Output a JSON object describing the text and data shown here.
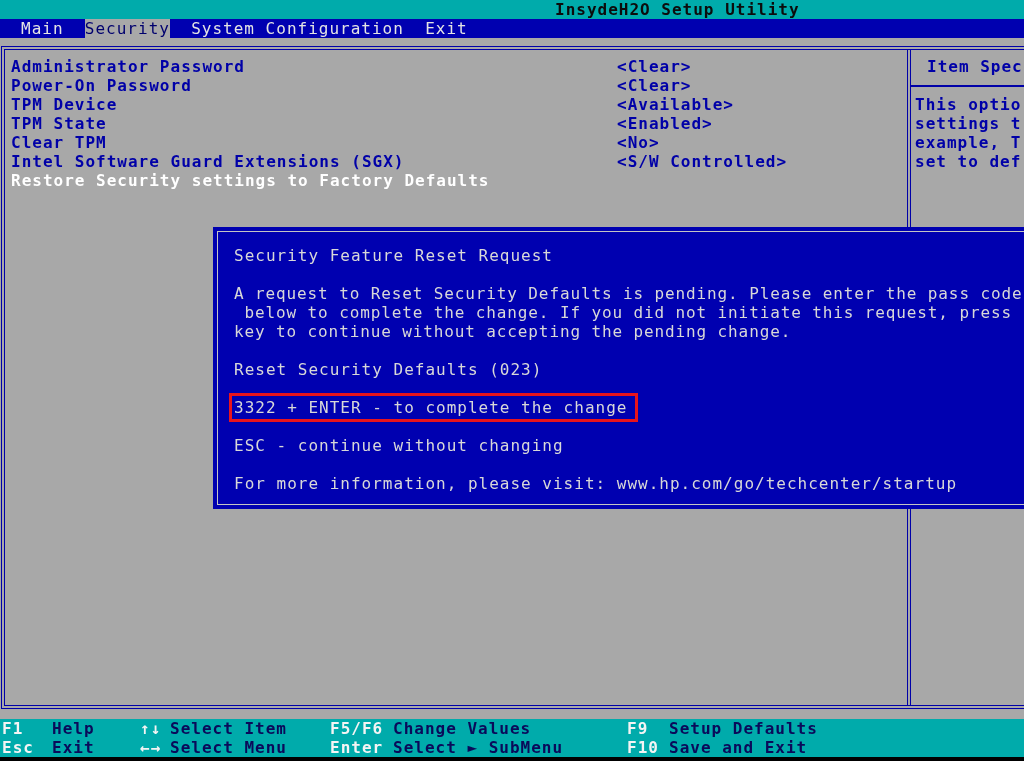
{
  "window": {
    "title": "InsydeH2O Setup Utility"
  },
  "tabs": [
    {
      "label": "Main",
      "selected": false
    },
    {
      "label": "Security",
      "selected": true
    },
    {
      "label": "System Configuration",
      "selected": false
    },
    {
      "label": "Exit",
      "selected": false
    }
  ],
  "settings": [
    {
      "label": "Administrator Password",
      "value": "<Clear>",
      "selected": false
    },
    {
      "label": "Power-On Password",
      "value": "<Clear>",
      "selected": false
    },
    {
      "label": "TPM Device",
      "value": "<Available>",
      "selected": false
    },
    {
      "label": "TPM State",
      "value": "<Enabled>",
      "selected": false
    },
    {
      "label": "Clear TPM",
      "value": "<No>",
      "selected": false
    },
    {
      "label": "Intel Software Guard Extensions (SGX)",
      "value": "<S/W Controlled>",
      "selected": false
    },
    {
      "label": "Restore Security settings to Factory Defaults",
      "selected": true
    }
  ],
  "help_panel": {
    "title": "Item Spec",
    "lines": [
      "This optio",
      "settings t",
      "example, T",
      "set to def"
    ]
  },
  "dialog": {
    "title": "Security Feature Reset Request",
    "message_lines": [
      "A request to Reset Security Defaults is pending. Please enter the pass code",
      " below to complete the change. If you did not initiate this request, press",
      "key to continue without accepting the pending change."
    ],
    "lines": [
      {
        "text": "Reset Security Defaults (023)",
        "highlighted": false
      },
      {
        "text": "3322 + ENTER - to complete the change",
        "highlighted": true
      },
      {
        "text": "ESC - continue without changing",
        "highlighted": false
      },
      {
        "text": "For more information, please visit: www.hp.com/go/techcenter/startup",
        "highlighted": false
      }
    ]
  },
  "status_bar": {
    "shortcuts": [
      {
        "key": "F1",
        "action": "Help"
      },
      {
        "key": "↑↓",
        "action": "Select Item"
      },
      {
        "key": "F5/F6",
        "action": "Change Values"
      },
      {
        "key": "F9",
        "action": "Setup Defaults"
      },
      {
        "key": "Esc",
        "action": "Exit"
      },
      {
        "key": "←→",
        "action": "Select Menu"
      },
      {
        "key": "Enter",
        "action": "Select ► SubMenu"
      },
      {
        "key": "F10",
        "action": "Save and Exit"
      }
    ]
  }
}
